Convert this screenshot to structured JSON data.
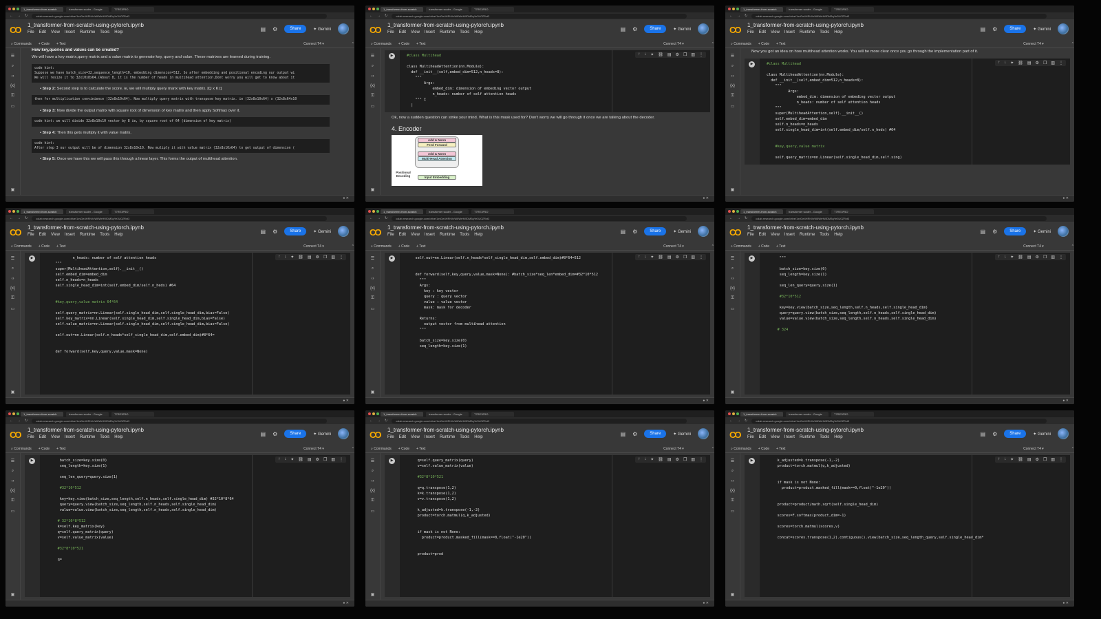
{
  "browser": {
    "tabs": [
      "1_transformer-from-scratch",
      "transformer scaler - Google",
      "T7RE3P5O"
    ],
    "url": "colab.research.google.com/drive/1xvDe4HRhXxW6WrHWDM3qYe3U0ZRxt3"
  },
  "colab": {
    "title": "1_transformer-from-scratch-using-pytorch.ipynb",
    "menu": [
      "File",
      "Edit",
      "View",
      "Insert",
      "Runtime",
      "Tools",
      "Help"
    ],
    "share": "Share",
    "gemini": "Gemini",
    "commands": "Commands",
    "add_code": "+ Code",
    "add_text": "+ Text",
    "connect": "Connect",
    "runtime": "T4"
  },
  "panels": [
    {
      "blocks": [
        {
          "type": "bold",
          "text": "How key,queries and values can be created?"
        },
        {
          "type": "md",
          "text": "We will have a key matrix,query matrix and a value matrix to generate key, query and value. These matrixes are learned during training."
        },
        {
          "type": "hint",
          "lines": [
            "code hint:",
            "Suppose we have batch_size=32,sequence_length=10, embedding dimension=512. So after embedding and positional encoding our output wi",
            "We will resize it to 32x10x8x64.(About 8, it is the number of heads in multihead attention.Dont worry you will get to know about it"
          ]
        },
        {
          "type": "step",
          "label": "Step 2:",
          "text": " Second step is to calculate the score. ie, we will multiply query marix with key matrix. [Q x K.t]"
        },
        {
          "type": "hint",
          "lines": [
            "",
            "then for multiplication convinience (32x8x10x64). Now multiply query matrix with transpose key matrix. ie (32x8x10x64) x (32x8x64x10"
          ]
        },
        {
          "type": "step",
          "label": "Step 3:",
          "text": " Now divide the output matrix with square root of dimension of key matrix and then apply Softmax over it."
        },
        {
          "type": "hint",
          "lines": [
            "code hint: we will divide 32x8x10x10 vector by 8 ie, by square root of 64 (dimension of key matrix)"
          ]
        },
        {
          "type": "step",
          "label": "Step 4:",
          "text": " Then this gets multiply it with value matrix."
        },
        {
          "type": "hint",
          "lines": [
            "code hint:",
            "After step 3 our output will be of dimension 32x8x10x10. Now muliply it with value matrix (32x8x10x64) to get output of dimension ("
          ]
        },
        {
          "type": "step",
          "label": "Step 5:",
          "text": " Once we have this we will pass this through a linear layer. This forms the output of multihead attention."
        }
      ]
    },
    {
      "blocks": [
        {
          "type": "code",
          "lines": [
            "#class Multihead",
            "",
            "class MultiheadAttention(nn.Module):",
            "  def __init__(self,embed_dim=512,n_heads=8):",
            "    \"\"\"",
            "        Args:",
            "            embed_dim: dimension of embeding vector output",
            "            n_heads: number of self attention heads",
            "    \"\"\" I",
            "  |"
          ]
        },
        {
          "type": "md",
          "text": "Ok, now a sudden question can strike your mind. What is this mask used for? Don't worry we will go through it once we are talking about the decoder."
        },
        {
          "type": "heading",
          "text": "4. Encoder"
        },
        {
          "type": "diagram",
          "labels": [
            "Add & Norm",
            "Feed Forward",
            "Add & Norm",
            "Multi-Head Attention",
            "Positional Encoding",
            "Input Embedding"
          ]
        }
      ]
    },
    {
      "blocks": [
        {
          "type": "md",
          "text": "Now you got an idea on how multihead attention works. You will be more clear once you go through the implementation part of it."
        },
        {
          "type": "code",
          "lines": [
            "#class Multihead",
            "",
            "class MultiheadAttention(nn.Module):",
            "  def __init__(self,embed_dim=512,n_heads=8):",
            "    \"\"\"",
            "          Args:",
            "              embed_dim: dimension of embeding vector output",
            "              n_heads: number of self attention heads",
            "    \"\"\"",
            "    super(MultiheadAttention,self).__init__()",
            "    self.embed_dim=embed_dim",
            "    self.n_heads=n_heads",
            "    self.single_head_dim=int(self.embed_dim/self.n_heds) #64",
            "",
            "",
            "    #key,query,value matrix",
            "",
            "    self.query_matrix=nn.Linear(self.single_head_dim,self.sing)"
          ]
        }
      ]
    },
    {
      "blocks": [
        {
          "type": "code",
          "lines": [
            "            n_heads: number of self attention heads",
            "    \"\"\"",
            "    super(MultiheadAttention,self).__init__()",
            "    self.embed_dim=embed_dim",
            "    self.n_heads=n_heads",
            "    self.single_head_dim=int(self.embed_dim/self.n_heds) #64",
            "",
            "",
            "    #key,query,value matrix 64*64",
            "",
            "    self.query_matrix=nn.Linear(self.single_head_dim,self.single_head_dim,bias=False)",
            "    self.key_matrix=nn.Linear(self.single_head_dim,self.single_head_dim,bias=False)",
            "    self.value_matrix=nn.Linear(self.single_head_dim,self.single_head_dim,bias=False)",
            "",
            "    self.out=nn.Linear(self.n_heads*self_single_head_dim,self.embed_dim)#8*64=",
            "",
            "",
            "    def forward(self,key,query,value,mask=None)"
          ]
        }
      ]
    },
    {
      "blocks": [
        {
          "type": "code",
          "lines": [
            "    self.out=nn.Linear(self.n_heads*self_single_head_dim,self.embed_dim)#8*64=512",
            "",
            "",
            "    def forward(self,key,query,value,mask=None): #batch_size*seq_len*embed_dim=#32*10*512",
            "      \"\"\"",
            "      Args:",
            "        key : key vector",
            "        query : query vector",
            "        value : value vector",
            "        mask: mask for decoder",
            "",
            "      Returns:",
            "        output vector from multihead attention",
            "      \"\"\"",
            "",
            "      batch_size=key.size(0)",
            "      seq_length=key.size(1)"
          ]
        }
      ]
    },
    {
      "blocks": [
        {
          "type": "code",
          "lines": [
            "      \"\"\"",
            "",
            "      batch_size=key.size(0)",
            "      seq_length=key.size(1)",
            "",
            "      seq_len_query=query.size(1)",
            "",
            "      #32*10*512",
            "",
            "      key=key.view(batch_size,seq_length,self.n_heads,self.single_head_dim)",
            "      query=query.view(batch_size,seq_length,self.n_heads,self.single_head_dim)",
            "      value=value.view(batch_size,seq_length,self.n_heads,self.single_head_dim)",
            "",
            "     # 324"
          ]
        }
      ]
    },
    {
      "blocks": [
        {
          "type": "code",
          "lines": [
            "      batch_size=key.size(0)",
            "      seq_length=key.size(1)",
            "",
            "      seq_len_query=query.size(1)",
            "",
            "      #32*10*512",
            "",
            "      key=key.view(batch_size,seq_length,self.n_heads,self.single_head_dim) #32*10*8*64",
            "      query=query.view(batch_size,seq_length,self.n_heads,self.single_head_dim)",
            "      value=value.view(batch_size,seq_length,self.n_heads,self.single_head_dim)",
            "",
            "     # 32*10*8*512",
            "     k=self.key_matrix(key)",
            "     q=self.query_matrix(query)",
            "     v=self.value_matrix(value)",
            "",
            "     #32*8*10*521",
            "",
            "     q="
          ]
        }
      ]
    },
    {
      "blocks": [
        {
          "type": "code",
          "lines": [
            "     q=self.query_matrix(query)",
            "     v=self.value_matrix(value)",
            "",
            "     #32*8*10*521",
            "",
            "     q=q.transpose(1,2)",
            "     k=k.transpose(1,2)",
            "     v=v.transpose(1,2)",
            "",
            "     k_adjusted=k.transpose(-1,-2)",
            "     product=torch.matmul(q,k_adjusted)",
            "",
            "",
            "     if mask is not None:",
            "       product=product.masked_fill(mask==0,float(\"-1e20\"))",
            "",
            "",
            "     product=prod"
          ]
        }
      ]
    },
    {
      "blocks": [
        {
          "type": "code",
          "lines": [
            "     k_adjusted=k.transpose(-1,-2)",
            "     product=torch.matmul(q,k_adjusted)",
            "",
            "",
            "     if mask is not None:",
            "       product=product.masked_fill(mask==0,float(\"-1e20\"))",
            "",
            "",
            "     product=product/math.sqrt(self.single_head_dim)",
            "",
            "     scores=F.softmax(product,dim=-1)",
            "",
            "     scores=torch.matmul(scores,v)",
            "",
            "     concat=scores.transpose(1,2).contiguous().view(batch_size,seq_length_query,self.single_head_dim*"
          ]
        }
      ]
    }
  ]
}
